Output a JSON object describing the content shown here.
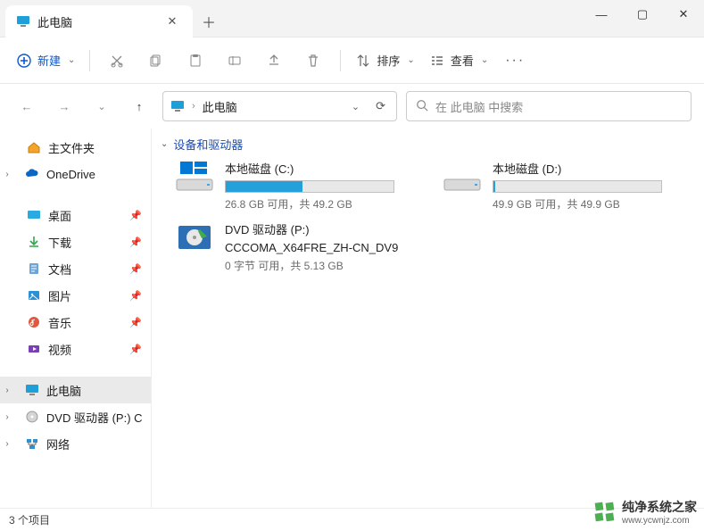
{
  "window": {
    "tab_title": "此电脑",
    "new_btn": "新建",
    "sort_btn": "排序",
    "view_btn": "查看"
  },
  "nav": {
    "address": "此电脑",
    "search_placeholder": "在 此电脑 中搜索"
  },
  "sidebar": {
    "home": "主文件夹",
    "onedrive": "OneDrive",
    "desktop": "桌面",
    "downloads": "下载",
    "documents": "文档",
    "pictures": "图片",
    "music": "音乐",
    "videos": "视频",
    "thispc": "此电脑",
    "dvd": "DVD 驱动器 (P:) C",
    "network": "网络"
  },
  "group": {
    "header": "设备和驱动器"
  },
  "drives": {
    "c": {
      "name": "本地磁盘 (C:)",
      "meta": "26.8 GB 可用，共 49.2 GB",
      "fill_pct": 46
    },
    "d": {
      "name": "本地磁盘 (D:)",
      "meta": "49.9 GB 可用，共 49.9 GB",
      "fill_pct": 1
    },
    "dvd": {
      "name": "DVD 驱动器 (P:)",
      "sub": "CCCOMA_X64FRE_ZH-CN_DV9",
      "meta": "0 字节 可用，共 5.13 GB"
    }
  },
  "status": {
    "count": "3 个项目"
  },
  "watermark": {
    "main": "纯净系统之家",
    "sub": "www.ycwnjz.com"
  }
}
